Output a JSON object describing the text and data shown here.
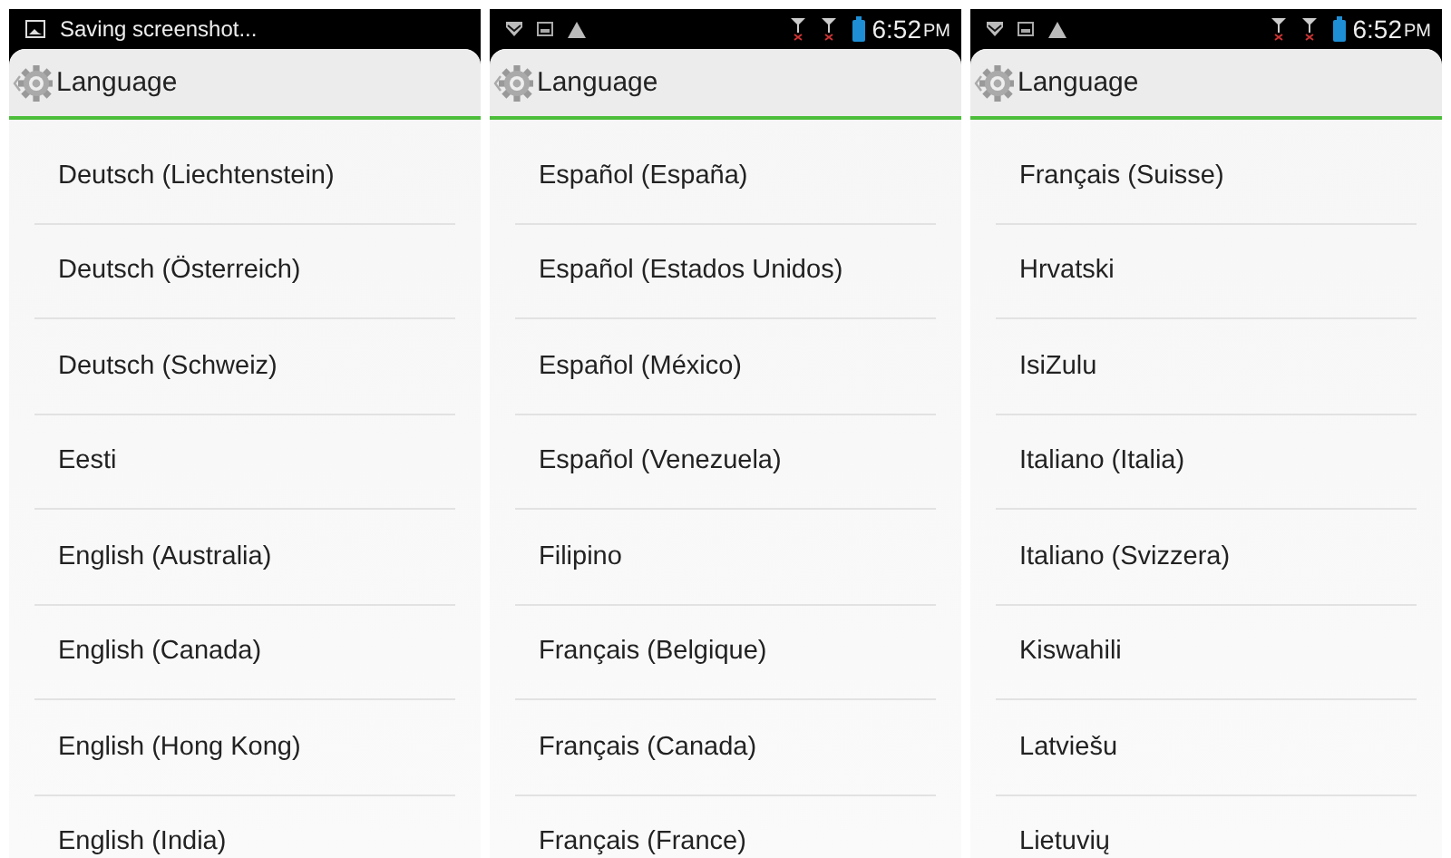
{
  "panels": [
    {
      "status_bar": {
        "kind": "ticker",
        "text": "Saving screenshot..."
      },
      "title": "Language",
      "items": [
        "Deutsch (Liechtenstein)",
        "Deutsch (Österreich)",
        "Deutsch (Schweiz)",
        "Eesti",
        "English (Australia)",
        "English (Canada)",
        "English (Hong Kong)",
        "English (India)"
      ]
    },
    {
      "status_bar": {
        "kind": "icons",
        "time": "6:52",
        "meridiem": "PM"
      },
      "title": "Language",
      "items": [
        "Español (España)",
        "Español (Estados Unidos)",
        "Español (México)",
        "Español (Venezuela)",
        "Filipino",
        "Français (Belgique)",
        "Français (Canada)",
        "Français (France)"
      ]
    },
    {
      "status_bar": {
        "kind": "icons",
        "time": "6:52",
        "meridiem": "PM"
      },
      "title": "Language",
      "items": [
        "Français (Suisse)",
        "Hrvatski",
        "IsiZulu",
        "Italiano (Italia)",
        "Italiano (Svizzera)",
        "Kiswahili",
        "Latviešu",
        "Lietuvių"
      ]
    }
  ]
}
